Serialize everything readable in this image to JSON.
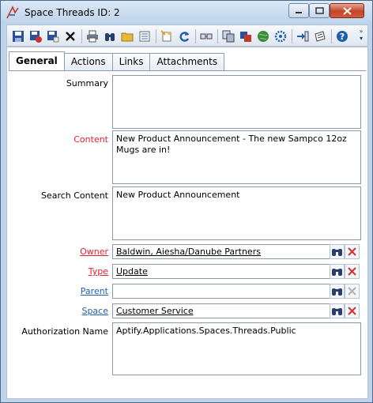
{
  "window": {
    "title": "Space Threads ID: 2",
    "icons": {
      "app": "aptify-logo-icon",
      "minimize": "minimize-icon",
      "maximize": "maximize-icon",
      "close": "close-icon"
    }
  },
  "toolbar": {
    "buttons": [
      "save-icon",
      "save-and-close-icon",
      "save-and-new-icon",
      "delete-icon",
      "print-icon",
      "find-icon",
      "open-folder-icon",
      "list-icon",
      "wizard-icon",
      "refresh-icon",
      "link-icon",
      "copy-icon",
      "multi-view-icon",
      "globe-icon",
      "gear-icon",
      "import-icon",
      "notes-icon",
      "help-icon"
    ]
  },
  "tabs": [
    "General",
    "Actions",
    "Links",
    "Attachments"
  ],
  "form": {
    "summary": {
      "label": "Summary",
      "value": ""
    },
    "content": {
      "label": "Content",
      "value": "New Product Announcement - The new Sampco 12oz Mugs are in!"
    },
    "search_content": {
      "label": "Search Content",
      "value": "New Product Announcement"
    },
    "owner": {
      "label": "Owner",
      "value": "Baldwin, Aiesha/Danube Partners"
    },
    "type": {
      "label": "Type",
      "value": "Update"
    },
    "parent": {
      "label": "Parent",
      "value": ""
    },
    "space": {
      "label": "Space",
      "value": "Customer Service"
    },
    "authorization_name": {
      "label": "Authorization Name",
      "value": "Aptify.Applications.Spaces.Threads.Public"
    }
  },
  "colors": {
    "required_label": "#e0202f",
    "link_label": "#1f5fa8",
    "title_bar": "#bcd2ea",
    "close_button": "#c2452a"
  }
}
